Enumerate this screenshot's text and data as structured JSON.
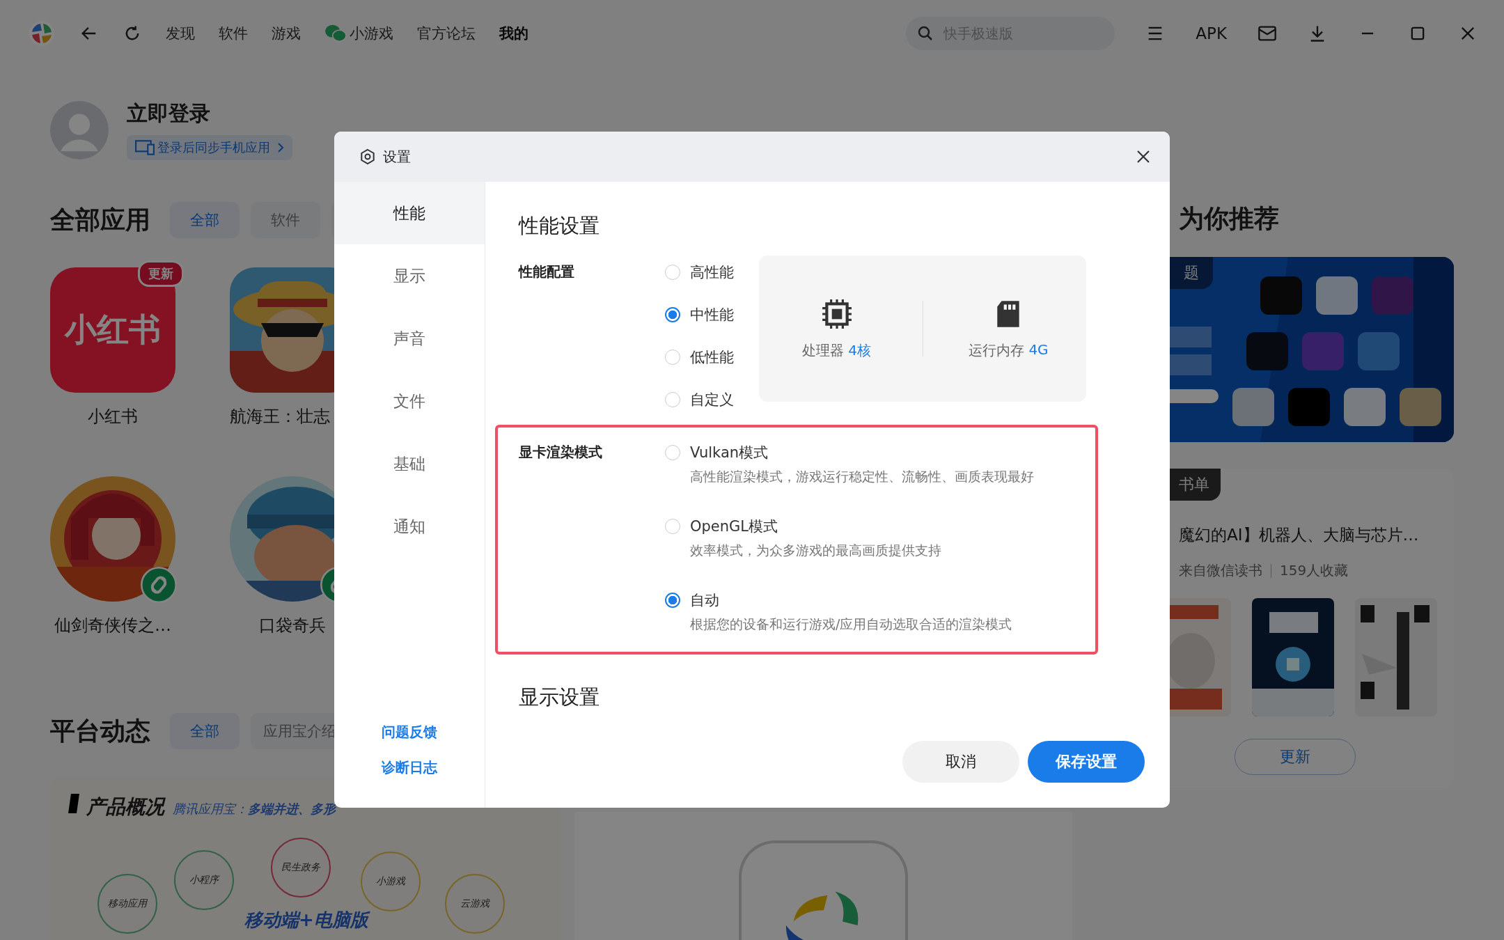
{
  "topbar": {
    "nav": [
      {
        "label": "发现",
        "kind": "text",
        "selected": false
      },
      {
        "label": "软件",
        "kind": "text",
        "selected": false
      },
      {
        "label": "游戏",
        "kind": "text",
        "selected": false
      },
      {
        "label": "小游戏",
        "kind": "wechat",
        "selected": false
      },
      {
        "label": "官方论坛",
        "kind": "text",
        "selected": false
      },
      {
        "label": "我的",
        "kind": "text",
        "selected": true
      }
    ],
    "search": {
      "placeholder": "快手极速版"
    },
    "apk": "APK"
  },
  "account": {
    "title": "立即登录",
    "sync_link": "登录后同步手机应用"
  },
  "all_apps": {
    "title": "全部应用",
    "tabs": [
      {
        "label": "全部",
        "selected": true
      },
      {
        "label": "软件",
        "selected": false
      }
    ],
    "apps": [
      {
        "name": "小红书",
        "kind": "brand",
        "icon_text": "小红书",
        "badge": "更新",
        "mini_program": false
      },
      {
        "name": "航海王：壮志",
        "kind": "picture",
        "mini_program": false
      },
      {
        "name": "仙剑奇侠传之…",
        "kind": "picture",
        "mini_program": true
      },
      {
        "name": "口袋奇兵",
        "kind": "picture",
        "mini_program": true
      }
    ]
  },
  "platform_news": {
    "title": "平台动态",
    "tabs": [
      {
        "label": "全部",
        "selected": true
      },
      {
        "label": "应用宝介绍",
        "selected": false
      }
    ],
    "overview": {
      "title": "产品概况",
      "subtitle": "腾讯应用宝：**多端并进、多形**",
      "headline": "移动端+电脑版",
      "bubbles": [
        {
          "label": "移动应用",
          "kind": "app"
        },
        {
          "label": "小程序",
          "kind": "app"
        },
        {
          "label": "民生政务",
          "kind": "civic"
        },
        {
          "label": "小游戏",
          "kind": "game"
        },
        {
          "label": "云游戏",
          "kind": "game"
        }
      ]
    }
  },
  "recommend": {
    "title": "为你推荐",
    "banner_tag": "题",
    "booklist": {
      "tag": "书单",
      "title": "魔幻的AI】机器人、大脑与芯片…",
      "source": "来自微信读书",
      "saves": "159人收藏",
      "button": "更新"
    }
  },
  "dialog": {
    "title": "设置",
    "nav": [
      {
        "label": "性能",
        "selected": true
      },
      {
        "label": "显示",
        "selected": false
      },
      {
        "label": "声音",
        "selected": false
      },
      {
        "label": "文件",
        "selected": false
      },
      {
        "label": "基础",
        "selected": false
      },
      {
        "label": "通知",
        "selected": false
      }
    ],
    "links": [
      "问题反馈",
      "诊断日志"
    ],
    "section_title": "性能设置",
    "profile": {
      "label": "性能配置",
      "options": [
        {
          "label": "高性能",
          "selected": false
        },
        {
          "label": "中性能",
          "selected": true
        },
        {
          "label": "低性能",
          "selected": false
        },
        {
          "label": "自定义",
          "selected": false
        }
      ]
    },
    "specs": [
      {
        "kind": "cpu",
        "label": "处理器",
        "value": "4核"
      },
      {
        "kind": "memory",
        "label": "运行内存",
        "value": "4G"
      }
    ],
    "render": {
      "label": "显卡渲染模式",
      "highlighted": true,
      "options": [
        {
          "label": "Vulkan模式",
          "description": "高性能渲染模式，游戏运行稳定性、流畅性、画质表现最好",
          "selected": false
        },
        {
          "label": "OpenGL模式",
          "description": "效率模式，为众多游戏的最高画质提供支持",
          "selected": false
        },
        {
          "label": "自动",
          "description": "根据您的设备和运行游戏/应用自动选取合适的渲染模式",
          "selected": true
        }
      ]
    },
    "next_section_title": "显示设置",
    "buttons": [
      {
        "label": "取消",
        "kind": "secondary"
      },
      {
        "label": "保存设置",
        "kind": "primary"
      }
    ]
  }
}
